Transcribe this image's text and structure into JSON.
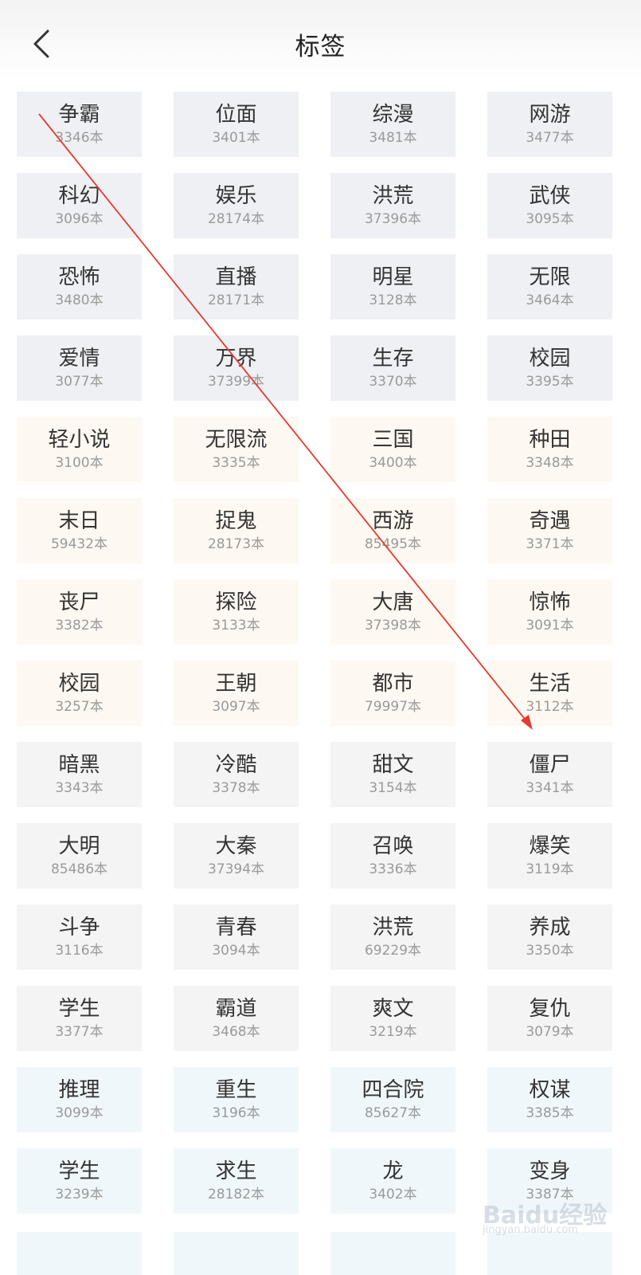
{
  "header": {
    "title": "标签"
  },
  "tags": [
    {
      "name": "争霸",
      "count": "3346本",
      "tone": "gray"
    },
    {
      "name": "位面",
      "count": "3401本",
      "tone": "gray"
    },
    {
      "name": "综漫",
      "count": "3481本",
      "tone": "gray"
    },
    {
      "name": "网游",
      "count": "3477本",
      "tone": "gray"
    },
    {
      "name": "科幻",
      "count": "3096本",
      "tone": "gray"
    },
    {
      "name": "娱乐",
      "count": "28174本",
      "tone": "gray"
    },
    {
      "name": "洪荒",
      "count": "37396本",
      "tone": "gray"
    },
    {
      "name": "武侠",
      "count": "3095本",
      "tone": "gray"
    },
    {
      "name": "恐怖",
      "count": "3480本",
      "tone": "gray"
    },
    {
      "name": "直播",
      "count": "28171本",
      "tone": "gray"
    },
    {
      "name": "明星",
      "count": "3128本",
      "tone": "gray"
    },
    {
      "name": "无限",
      "count": "3464本",
      "tone": "gray"
    },
    {
      "name": "爱情",
      "count": "3077本",
      "tone": "gray"
    },
    {
      "name": "万界",
      "count": "37399本",
      "tone": "gray"
    },
    {
      "name": "生存",
      "count": "3370本",
      "tone": "gray"
    },
    {
      "name": "校园",
      "count": "3395本",
      "tone": "gray"
    },
    {
      "name": "轻小说",
      "count": "3100本",
      "tone": "warm"
    },
    {
      "name": "无限流",
      "count": "3335本",
      "tone": "warm"
    },
    {
      "name": "三国",
      "count": "3400本",
      "tone": "warm"
    },
    {
      "name": "种田",
      "count": "3348本",
      "tone": "warm"
    },
    {
      "name": "末日",
      "count": "59432本",
      "tone": "warm"
    },
    {
      "name": "捉鬼",
      "count": "28173本",
      "tone": "warm"
    },
    {
      "name": "西游",
      "count": "85495本",
      "tone": "warm"
    },
    {
      "name": "奇遇",
      "count": "3371本",
      "tone": "warm"
    },
    {
      "name": "丧尸",
      "count": "3382本",
      "tone": "warm"
    },
    {
      "name": "探险",
      "count": "3133本",
      "tone": "warm"
    },
    {
      "name": "大唐",
      "count": "37398本",
      "tone": "warm"
    },
    {
      "name": "惊怖",
      "count": "3091本",
      "tone": "warm"
    },
    {
      "name": "校园",
      "count": "3257本",
      "tone": "warm"
    },
    {
      "name": "王朝",
      "count": "3097本",
      "tone": "warm"
    },
    {
      "name": "都市",
      "count": "79997本",
      "tone": "warm"
    },
    {
      "name": "生活",
      "count": "3112本",
      "tone": "warm"
    },
    {
      "name": "暗黑",
      "count": "3343本",
      "tone": "plain"
    },
    {
      "name": "冷酷",
      "count": "3378本",
      "tone": "plain"
    },
    {
      "name": "甜文",
      "count": "3154本",
      "tone": "plain"
    },
    {
      "name": "僵尸",
      "count": "3341本",
      "tone": "plain"
    },
    {
      "name": "大明",
      "count": "85486本",
      "tone": "plain"
    },
    {
      "name": "大秦",
      "count": "37394本",
      "tone": "plain"
    },
    {
      "name": "召唤",
      "count": "3336本",
      "tone": "plain"
    },
    {
      "name": "爆笑",
      "count": "3119本",
      "tone": "plain"
    },
    {
      "name": "斗争",
      "count": "3116本",
      "tone": "plain"
    },
    {
      "name": "青春",
      "count": "3094本",
      "tone": "plain"
    },
    {
      "name": "洪荒",
      "count": "69229本",
      "tone": "plain"
    },
    {
      "name": "养成",
      "count": "3350本",
      "tone": "plain"
    },
    {
      "name": "学生",
      "count": "3377本",
      "tone": "plain"
    },
    {
      "name": "霸道",
      "count": "3468本",
      "tone": "plain"
    },
    {
      "name": "爽文",
      "count": "3219本",
      "tone": "plain"
    },
    {
      "name": "复仇",
      "count": "3079本",
      "tone": "plain"
    },
    {
      "name": "推理",
      "count": "3099本",
      "tone": "blue"
    },
    {
      "name": "重生",
      "count": "3196本",
      "tone": "blue"
    },
    {
      "name": "四合院",
      "count": "85627本",
      "tone": "blue"
    },
    {
      "name": "权谋",
      "count": "3385本",
      "tone": "blue"
    },
    {
      "name": "学生",
      "count": "3239本",
      "tone": "blue"
    },
    {
      "name": "求生",
      "count": "28182本",
      "tone": "blue"
    },
    {
      "name": "龙",
      "count": "3402本",
      "tone": "blue"
    },
    {
      "name": "变身",
      "count": "3387本",
      "tone": "blue"
    }
  ],
  "watermark": {
    "text": "Baidu经验",
    "sub": "jingyan.baidu.com"
  },
  "colors": {
    "arrow": "#e8392e",
    "tag_gray": "#eef0f3",
    "tag_warm": "#fdf8f1",
    "tag_plain": "#f4f4f4",
    "tag_blue": "#f0f7fb"
  }
}
